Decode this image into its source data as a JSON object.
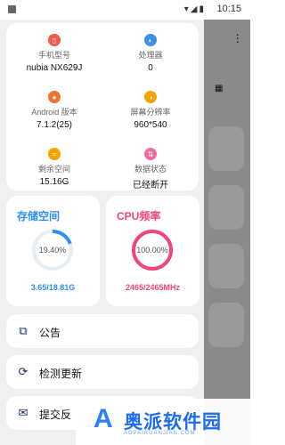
{
  "status_bar": {
    "time": "10:15",
    "icons": "▾◢▮"
  },
  "device_info": [
    {
      "label": "手机型号",
      "value": "nubia NX629J",
      "icon": "phone-icon",
      "color": "#f25a4a"
    },
    {
      "label": "处理器",
      "value": "0",
      "icon": "cpu-icon",
      "color": "#3d8fe8"
    },
    {
      "label": "Android 版本",
      "value": "7.1.2(25)",
      "icon": "android-icon",
      "color": "#f2702e"
    },
    {
      "label": "屏幕分辨率",
      "value": "960*540",
      "icon": "screen-icon",
      "color": "#f5a300"
    },
    {
      "label": "剩余空间",
      "value": "15.16G",
      "icon": "storage-icon",
      "color": "#f5a300"
    },
    {
      "label": "数据状态",
      "value": "已经断开",
      "icon": "data-icon",
      "color": "#f46aa0"
    }
  ],
  "storage": {
    "title": "存储空间",
    "percent_text": "19.40%",
    "percent": 19.4,
    "detail": "3.65/18.81G",
    "color": "#2f8ef0"
  },
  "cpu": {
    "title": "CPU频率",
    "percent_text": "100.00%",
    "percent": 100,
    "detail": "2465/2465MHz",
    "color": "#f2457a"
  },
  "menu": [
    {
      "label": "公告",
      "icon": "notice-icon",
      "glyph": "⧉"
    },
    {
      "label": "检测更新",
      "icon": "update-icon",
      "glyph": "⟳"
    },
    {
      "label": "提交反",
      "icon": "feedback-icon",
      "glyph": "✉"
    }
  ],
  "watermark": {
    "title": "奥派软件园",
    "subtitle": "AOPAIRUANJIAN.COM"
  }
}
